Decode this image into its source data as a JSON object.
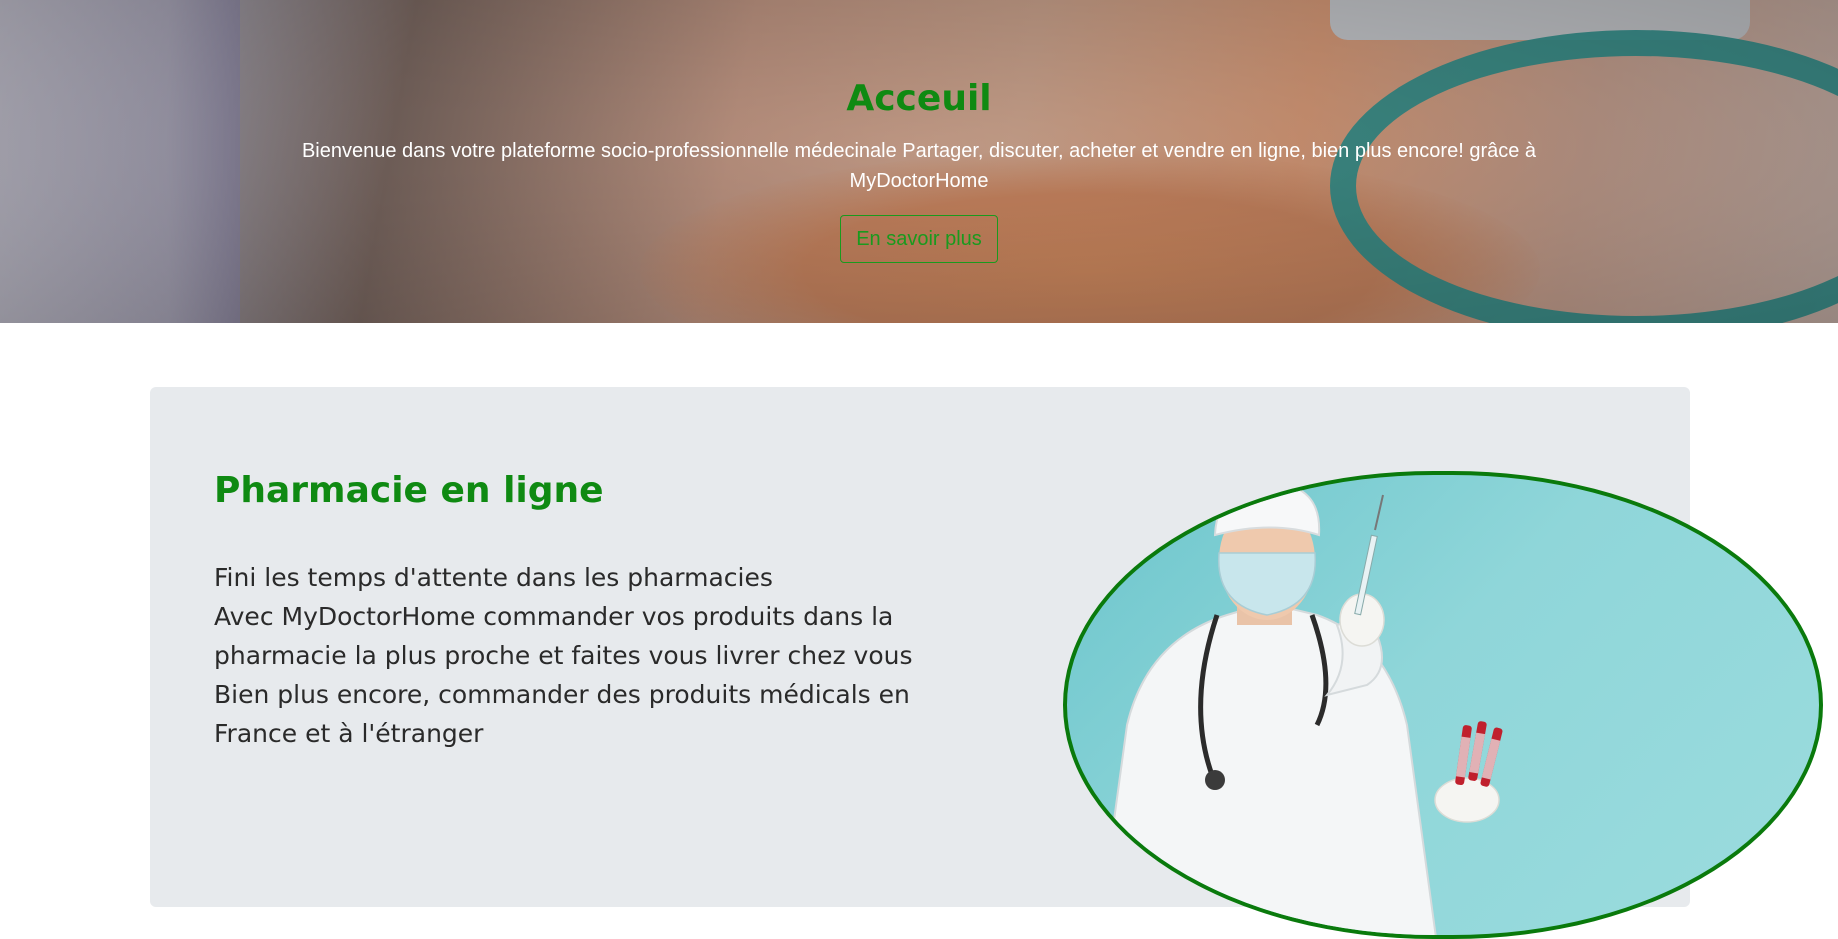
{
  "hero": {
    "title": "Acceuil",
    "text": "Bienvenue dans votre plateforme socio-professionnelle médecinale Partager, discuter, acheter et vendre en ligne, bien plus encore! grâce à MyDoctorHome",
    "button_label": "En savoir plus"
  },
  "pharmacy": {
    "title": "Pharmacie en ligne",
    "lines": [
      "Fini les temps d'attente dans les pharmacies",
      "Avec MyDoctorHome commander vos produits dans la",
      "pharmacie la plus proche et faites vous livrer chez vous",
      "Bien plus encore, commander des produits médicals en",
      "France et à l'étranger"
    ]
  },
  "colors": {
    "accent": "#0f8a12",
    "card_bg": "#e7eaed"
  }
}
